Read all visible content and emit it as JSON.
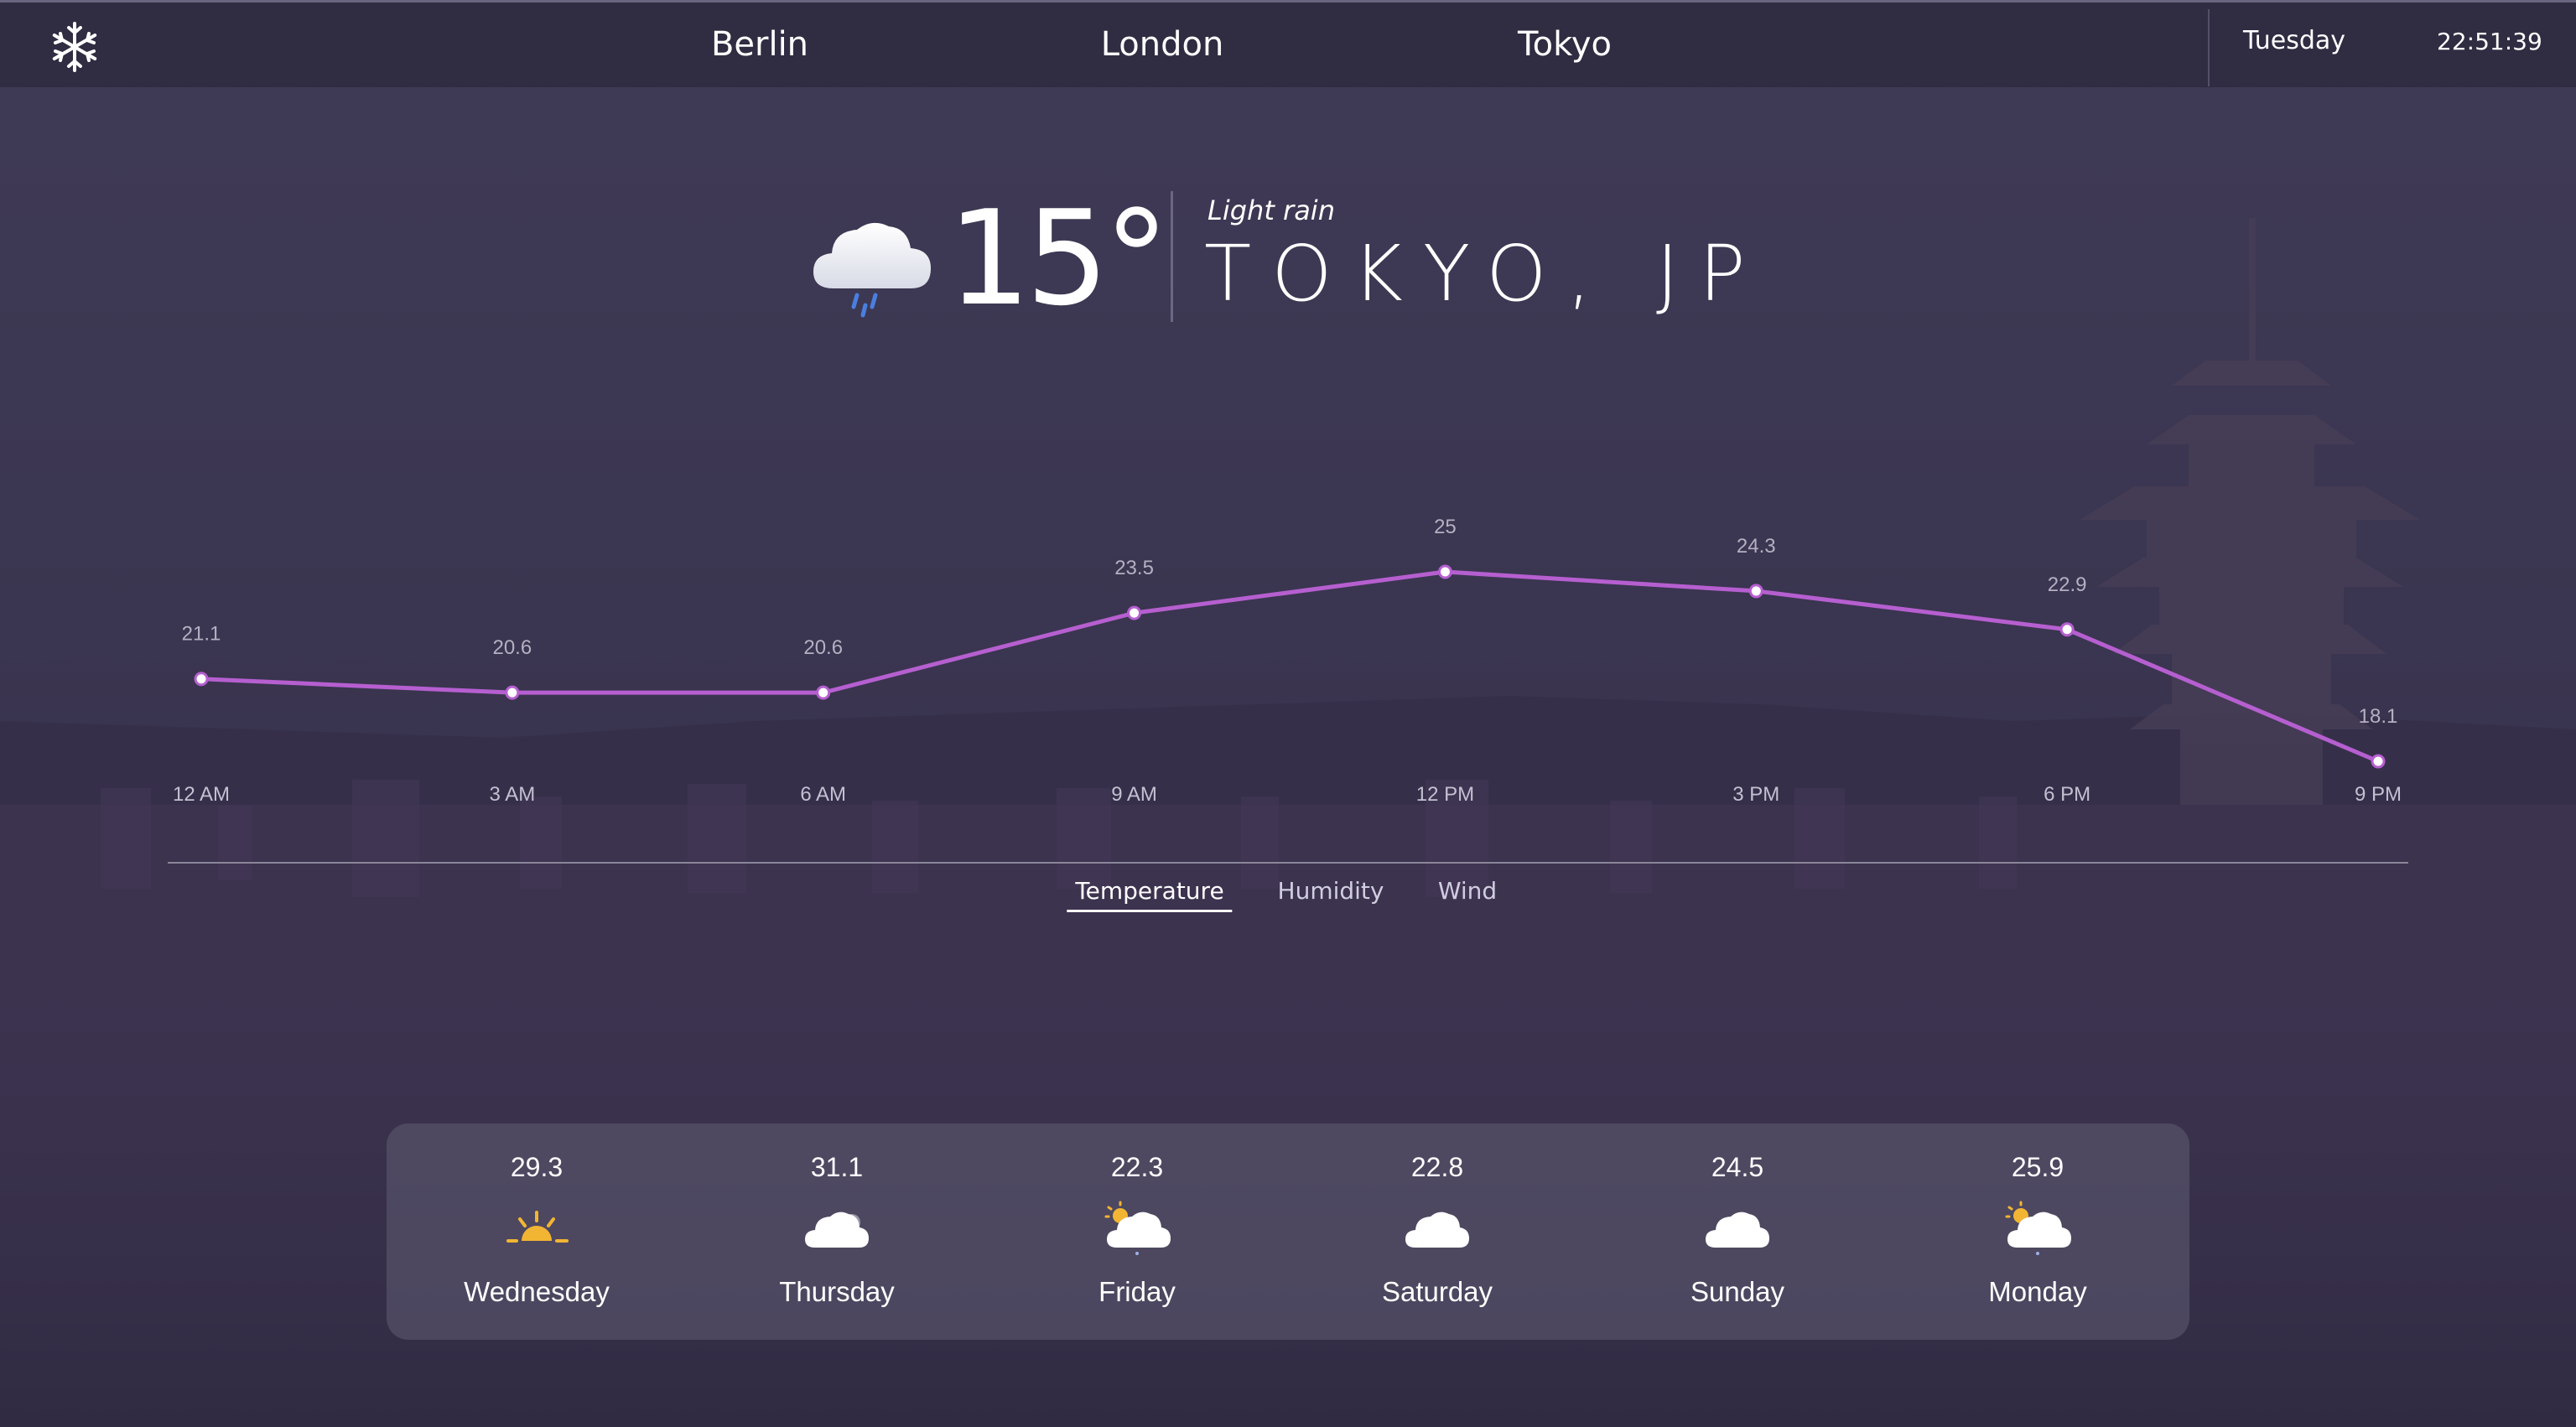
{
  "header": {
    "logo_icon": "snowflake-icon",
    "cities": [
      "Berlin",
      "London",
      "Tokyo"
    ],
    "day": "Tuesday",
    "time": "22:51:39"
  },
  "current": {
    "icon": "rain-cloud-icon",
    "temperature": "15°",
    "condition": "Light rain",
    "location": "TOKYO, JP"
  },
  "chart_data": {
    "type": "line",
    "categories": [
      "12 AM",
      "3 AM",
      "6 AM",
      "9 AM",
      "12 PM",
      "3 PM",
      "6 PM",
      "9 PM"
    ],
    "values": [
      21.1,
      20.6,
      20.6,
      23.5,
      25,
      24.3,
      22.9,
      18.1
    ],
    "title": "",
    "xlabel": "",
    "ylabel": "",
    "line_color": "#b65fd0",
    "grid": false
  },
  "metric_tabs": {
    "items": [
      "Temperature",
      "Humidity",
      "Wind"
    ],
    "active": "Temperature"
  },
  "forecast": [
    {
      "day": "Wednesday",
      "temp": "29.3",
      "icon": "sun-icon"
    },
    {
      "day": "Thursday",
      "temp": "31.1",
      "icon": "cloud-icon"
    },
    {
      "day": "Friday",
      "temp": "22.3",
      "icon": "sun-cloud-icon"
    },
    {
      "day": "Saturday",
      "temp": "22.8",
      "icon": "cloud-icon"
    },
    {
      "day": "Sunday",
      "temp": "24.5",
      "icon": "cloud-icon"
    },
    {
      "day": "Monday",
      "temp": "25.9",
      "icon": "sun-cloud-icon"
    }
  ]
}
